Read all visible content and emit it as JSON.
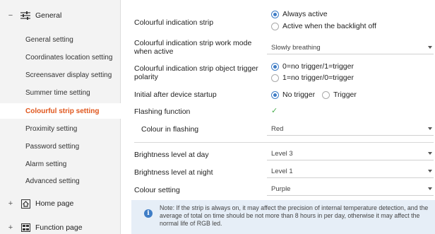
{
  "sidebar": {
    "general": {
      "toggle": "−",
      "icon": "sliders-icon",
      "label": "General"
    },
    "items": [
      {
        "label": "General setting"
      },
      {
        "label": "Coordinates location setting"
      },
      {
        "label": "Screensaver display setting"
      },
      {
        "label": "Summer time setting"
      },
      {
        "label": "Colourful strip setting",
        "active": true
      },
      {
        "label": "Proximity setting"
      },
      {
        "label": "Password setting"
      },
      {
        "label": "Alarm setting"
      },
      {
        "label": "Advanced setting"
      }
    ],
    "home": {
      "toggle": "+",
      "icon": "home-icon",
      "label": "Home page"
    },
    "function": {
      "toggle": "+",
      "icon": "grid-icon",
      "label": "Function page"
    }
  },
  "main": {
    "strip": {
      "label": "Colourful indication strip",
      "options": [
        "Always active",
        "Active when the backlight off"
      ],
      "selected": 0
    },
    "work_mode": {
      "label_line1": "Colourful indication strip work mode",
      "label_line2": "when active",
      "value": "Slowly breathing"
    },
    "polarity": {
      "label": "Colourful  indication strip object trigger",
      "label_line2": "polarity",
      "options": [
        "0=no trigger/1=trigger",
        "1=no trigger/0=trigger"
      ],
      "selected": 0
    },
    "startup": {
      "label": "Initial after device startup",
      "options": [
        "No trigger",
        "Trigger"
      ],
      "selected": 0
    },
    "flashing": {
      "label": "Flashing function",
      "checked": true,
      "check_glyph": "✓"
    },
    "flash_colour": {
      "label": "Colour in flashing",
      "value": "Red"
    },
    "brightness_day": {
      "label": "Brightness level at day",
      "value": "Level 3"
    },
    "brightness_night": {
      "label": "Brightness level at night",
      "value": "Level 1"
    },
    "colour_setting": {
      "label": "Colour setting",
      "value": "Purple"
    },
    "note": {
      "icon": "info-icon",
      "icon_glyph": "i",
      "text": "Note: If the strip is always on, it may affect the precision of internal temperature detection, and the average of total on time should be not more than 8 hours in per day, otherwise it may affect the normal life of RGB led."
    }
  },
  "colors": {
    "accent": "#e0561c",
    "radio": "#3f7dc6",
    "check": "#4caf50",
    "note_bg": "#e6eef7"
  }
}
